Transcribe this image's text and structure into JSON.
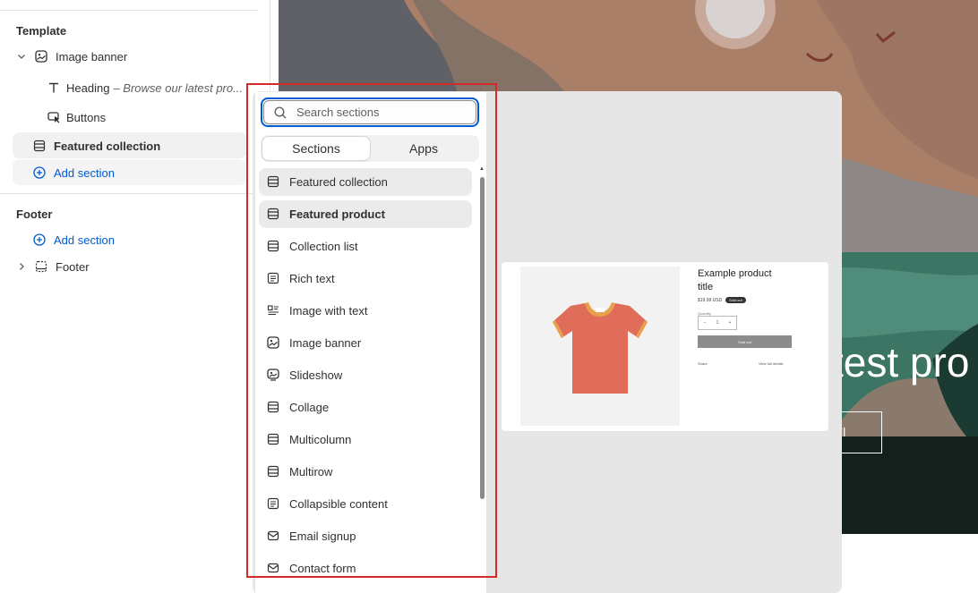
{
  "sidebar": {
    "template_title": "Template",
    "image_banner": "Image banner",
    "heading_label": "Heading",
    "heading_sub": "– Browse our latest pro...",
    "buttons": "Buttons",
    "featured_collection": "Featured collection",
    "add_section": "Add section",
    "footer_title": "Footer",
    "footer_add_section": "Add section",
    "footer_item": "Footer"
  },
  "popover": {
    "search_placeholder": "Search sections",
    "tabs": [
      "Sections",
      "Apps"
    ],
    "items": [
      {
        "label": "Featured collection",
        "icon": "featured-collection-icon"
      },
      {
        "label": "Featured product",
        "icon": "featured-product-icon"
      },
      {
        "label": "Collection list",
        "icon": "collection-list-icon"
      },
      {
        "label": "Rich text",
        "icon": "rich-text-icon"
      },
      {
        "label": "Image with text",
        "icon": "image-with-text-icon"
      },
      {
        "label": "Image banner",
        "icon": "image-banner-icon"
      },
      {
        "label": "Slideshow",
        "icon": "slideshow-icon"
      },
      {
        "label": "Collage",
        "icon": "collage-icon"
      },
      {
        "label": "Multicolumn",
        "icon": "multicolumn-icon"
      },
      {
        "label": "Multirow",
        "icon": "multirow-icon"
      },
      {
        "label": "Collapsible content",
        "icon": "collapsible-content-icon"
      },
      {
        "label": "Email signup",
        "icon": "email-signup-icon"
      },
      {
        "label": "Contact form",
        "icon": "contact-form-icon"
      }
    ]
  },
  "preview": {
    "hero_title": "test pro",
    "hero_button": "ll",
    "product_title": "Example product title",
    "product_price": "$19.99 USD",
    "badge": "Sold out",
    "quantity_label": "Quantity",
    "quantity_value": "1",
    "sold_out_button": "Sold out",
    "share": "Share",
    "view_details": "View full details"
  },
  "colors": {
    "accent": "#005bd3",
    "highlight_box": "#d42a2a",
    "tshirt": "#e06c5a",
    "tshirt_trim": "#e9a04b"
  }
}
